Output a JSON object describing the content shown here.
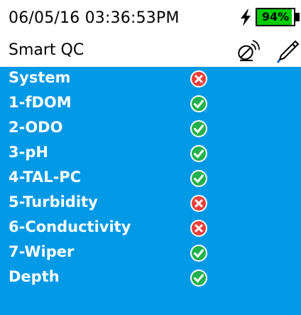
{
  "status": {
    "datetime": "06/05/16  03:36:53PM",
    "battery_percent": 94,
    "battery_label": "94%",
    "charging": true,
    "battery_color": "#00cc00"
  },
  "header": {
    "title": "Smart QC",
    "icons": [
      "satellite-icon",
      "pen-icon"
    ]
  },
  "colors": {
    "panel_bg": "#0099e6",
    "pass": "#22b14c",
    "fail": "#e8403a"
  },
  "checks": [
    {
      "label": "System",
      "status": "fail"
    },
    {
      "label": "1-fDOM",
      "status": "pass"
    },
    {
      "label": "2-ODO",
      "status": "pass"
    },
    {
      "label": "3-pH",
      "status": "pass"
    },
    {
      "label": "4-TAL-PC",
      "status": "pass"
    },
    {
      "label": "5-Turbidity",
      "status": "fail"
    },
    {
      "label": "6-Conductivity",
      "status": "fail"
    },
    {
      "label": "7-Wiper",
      "status": "pass"
    },
    {
      "label": "Depth",
      "status": "pass"
    }
  ]
}
